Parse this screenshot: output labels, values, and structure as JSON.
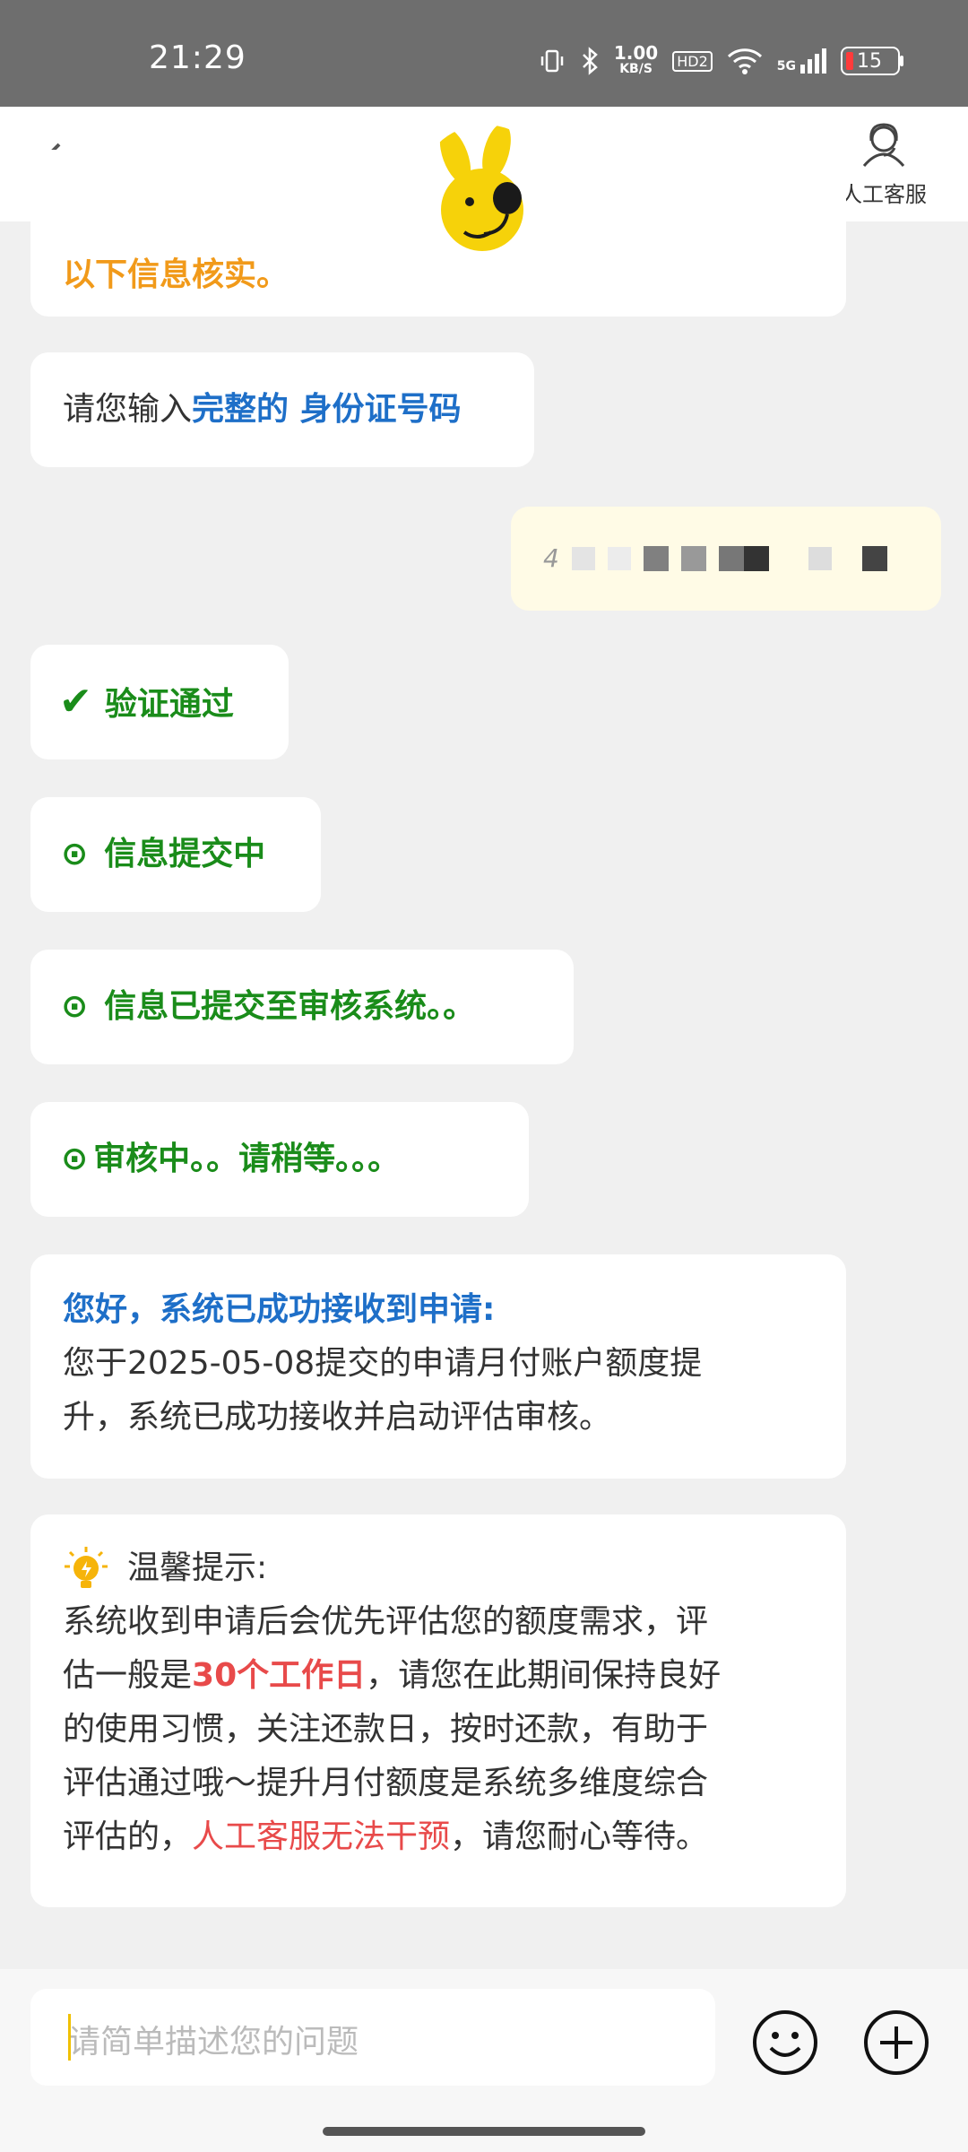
{
  "status_bar": {
    "time": "21:29",
    "net_speed_value": "1.00",
    "net_speed_unit": "KB/S",
    "hd_label": "HD2",
    "network": "5G",
    "battery": "15"
  },
  "header": {
    "back_icon": "chevron-left-icon",
    "mascot_icon": "yellow-rabbit-mascot-icon",
    "agent_label": "人工客服"
  },
  "messages": {
    "m0": {
      "text": "以下信息核实。"
    },
    "m1": {
      "prefix": "请您输入",
      "highlight": "完整的 身份证号码"
    },
    "m2": {
      "text": "4"
    },
    "m3": {
      "text": "验证通过"
    },
    "m4": {
      "text": "信息提交中"
    },
    "m5": {
      "text": "信息已提交至审核系统。。"
    },
    "m6": {
      "text": "审核中。。请稍等。。。"
    },
    "m7": {
      "title": "您好，系统已成功接收到申请:",
      "line1": "您于2025-05-08提交的申请月付账户额度提",
      "line2": "升，系统已成功接收并启动评估审核。"
    },
    "m8": {
      "title": "温馨提示:",
      "l1": "系统收到申请后会优先评估您的额度需求，评",
      "l2a": "估一般是",
      "l2b": "30个工作日",
      "l2c": "，请您在此期间保持良好",
      "l3": "的使用习惯，关注还款日，按时还款，有助于",
      "l4": "评估通过哦～提升月付额度是系统多维度综合",
      "l5a": "评估的，",
      "l5b": "人工客服无法干预",
      "l5c": "，请您耐心等待。"
    }
  },
  "input": {
    "placeholder": "请简单描述您的问题",
    "emoji_icon": "smiley-icon",
    "plus_icon": "plus-circle-icon"
  },
  "colors": {
    "accent_green": "#1a8c1a",
    "link_blue": "#1e6fc8",
    "warning_orange": "#f19a1a",
    "alert_red": "#e84a4a",
    "user_bubble": "#fffbe6"
  }
}
